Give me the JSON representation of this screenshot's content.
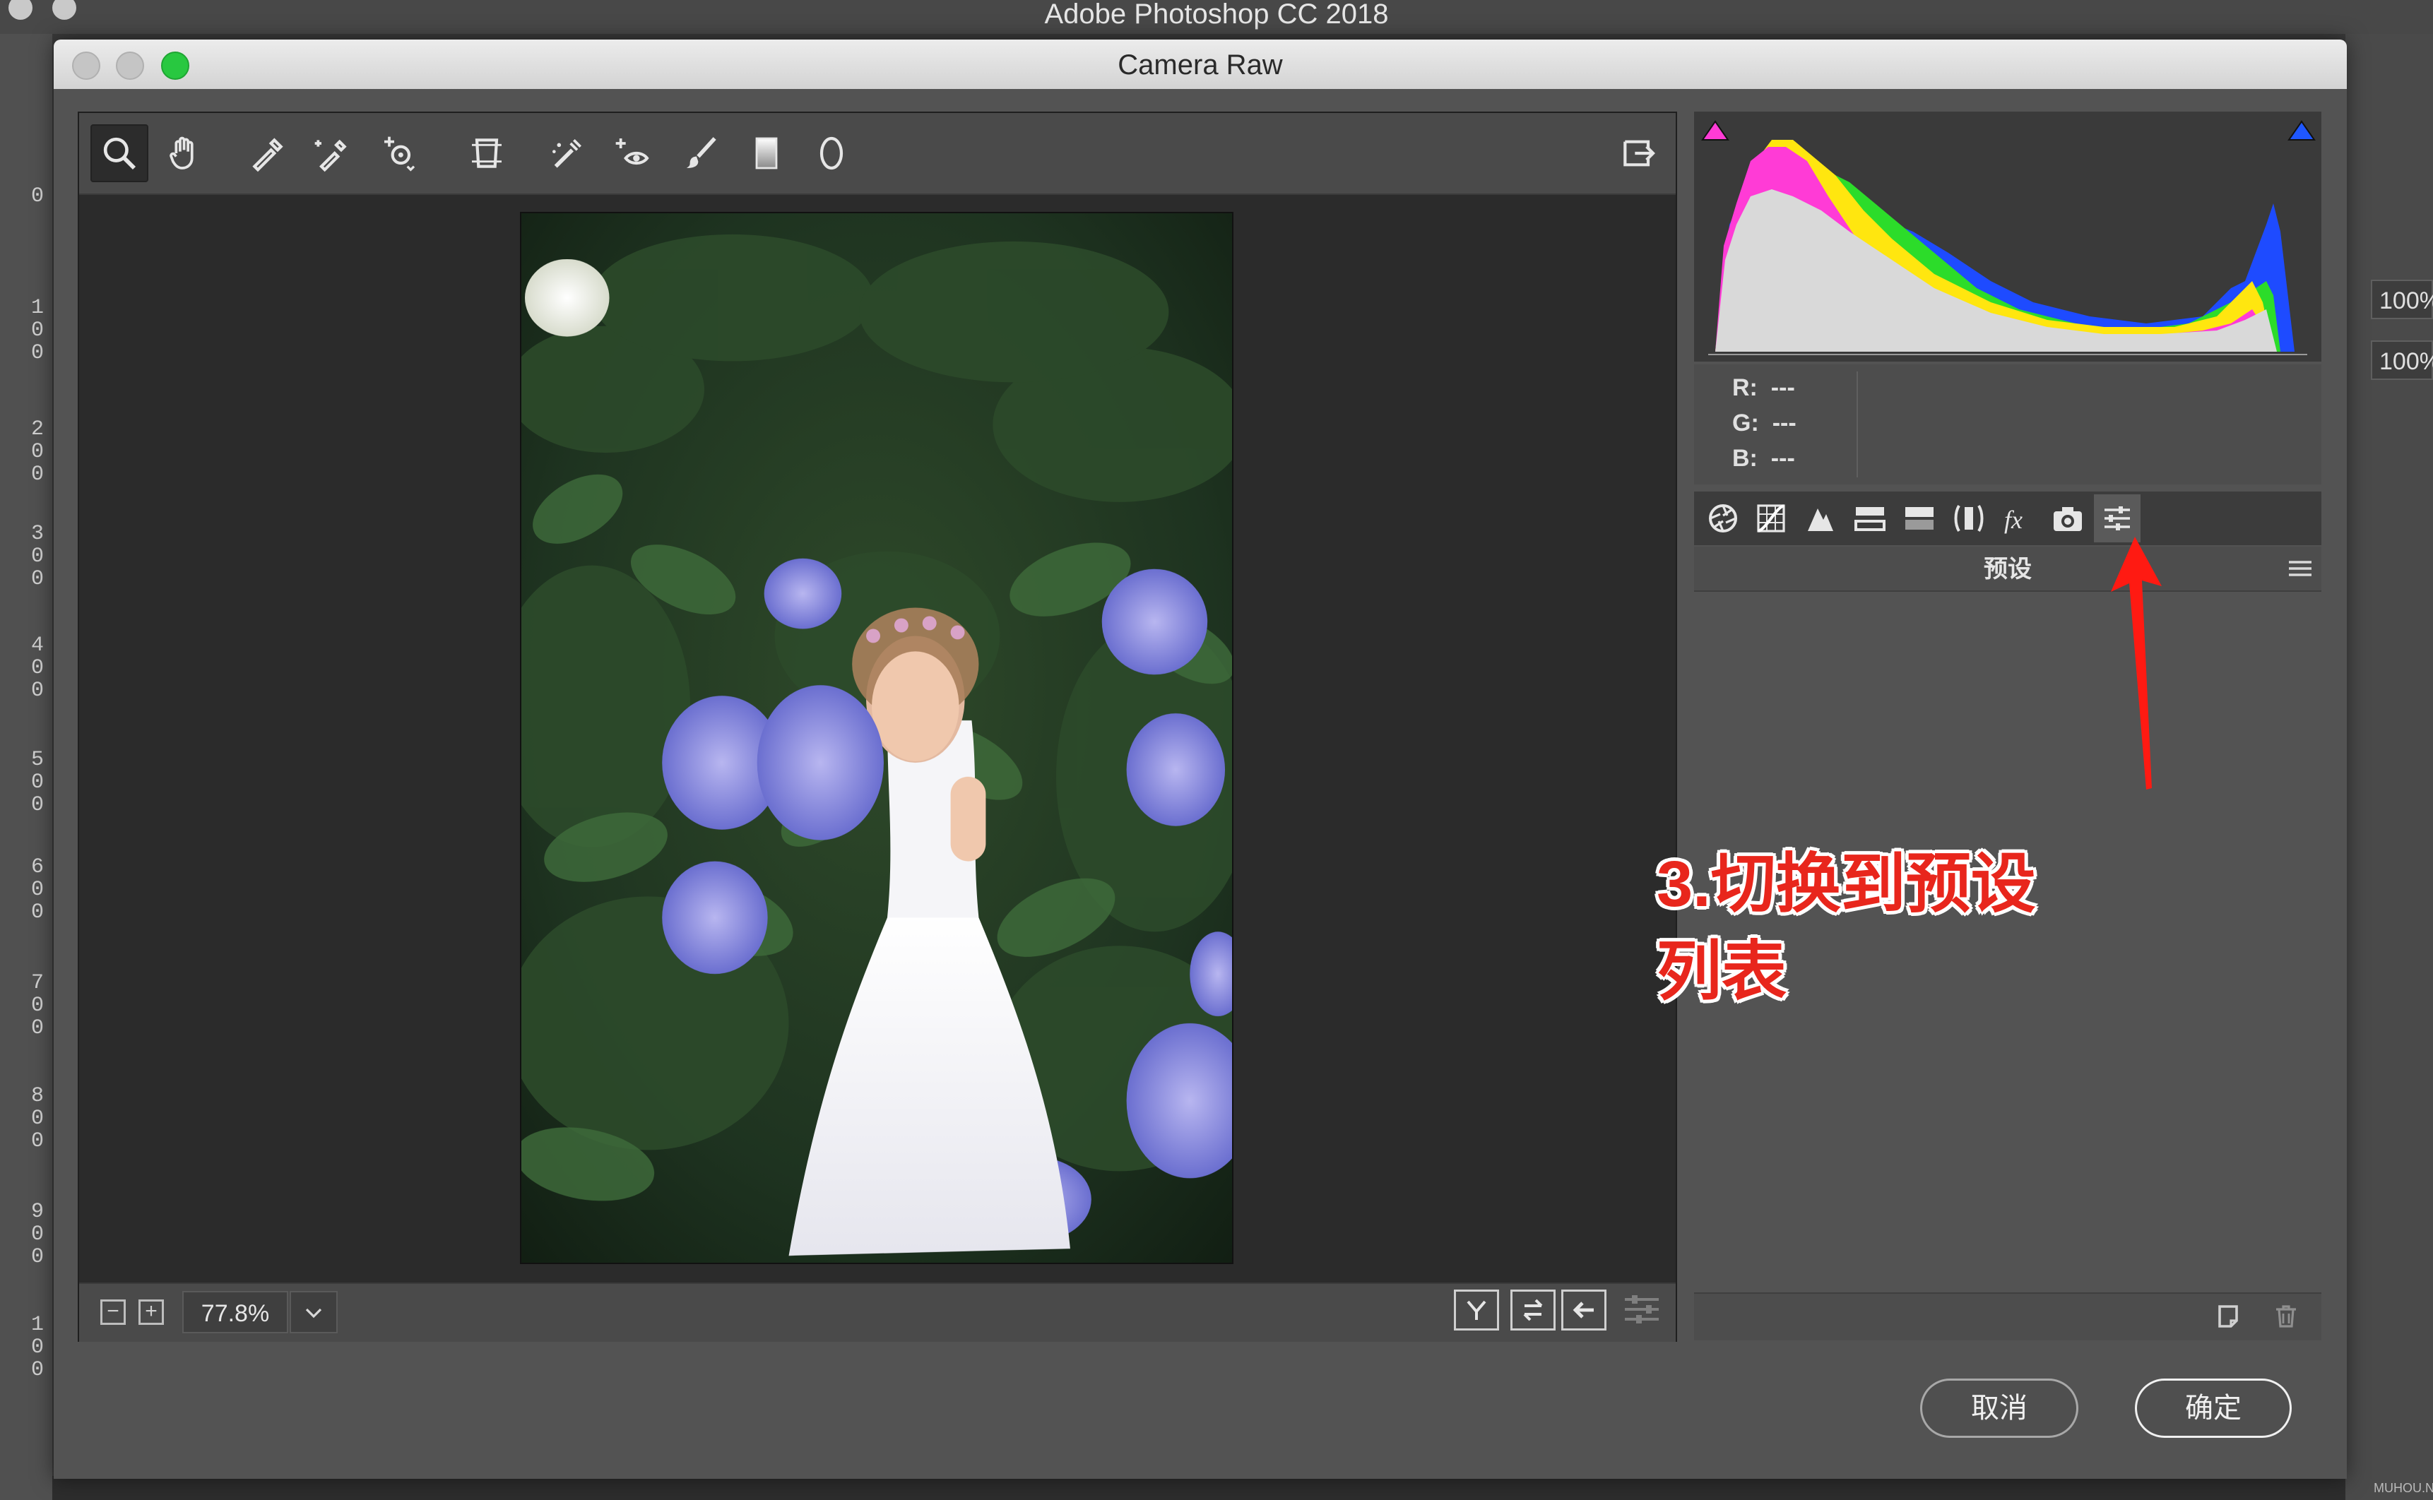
{
  "app": {
    "title": "Adobe Photoshop CC 2018",
    "left_ruler_marks": [
      "0",
      "1\n0\n0",
      "2\n0\n0",
      "3\n0\n0",
      "4\n0\n0",
      "5\n0\n0",
      "6\n0\n0",
      "7\n0\n0",
      "8\n0\n0",
      "9\n0\n0",
      "1\n0\n0"
    ],
    "right_panel_values": [
      "100%",
      "100%"
    ]
  },
  "dialog": {
    "title": "Camera Raw",
    "toolbar_tools": [
      {
        "name": "zoom-tool",
        "icon": "magnifier-icon",
        "active": true
      },
      {
        "name": "hand-tool",
        "icon": "hand-icon"
      },
      {
        "name": "white-balance-tool",
        "icon": "eyedropper-icon"
      },
      {
        "name": "color-sampler-tool",
        "icon": "color-sampler-icon"
      },
      {
        "name": "targeted-adjustment-tool",
        "icon": "target-adjust-icon"
      },
      {
        "name": "transform-tool",
        "icon": "transform-icon"
      },
      {
        "name": "spot-removal-tool",
        "icon": "spot-removal-icon"
      },
      {
        "name": "red-eye-removal-tool",
        "icon": "red-eye-icon"
      },
      {
        "name": "adjustment-brush-tool",
        "icon": "brush-icon"
      },
      {
        "name": "graduated-filter-tool",
        "icon": "gradient-icon"
      },
      {
        "name": "radial-filter-tool",
        "icon": "ellipse-icon"
      }
    ],
    "open_in_photoshop_icon": "export-icon",
    "zoom": {
      "value": "77.8%"
    },
    "readout": {
      "r_label": "R:",
      "r_value": "---",
      "g_label": "G:",
      "g_value": "---",
      "b_label": "B:",
      "b_value": "---"
    },
    "panel_tabs": [
      {
        "icon": "basic-aperture-icon"
      },
      {
        "icon": "tone-curve-icon"
      },
      {
        "icon": "detail-icon"
      },
      {
        "icon": "hsl-icon"
      },
      {
        "icon": "split-toning-icon"
      },
      {
        "icon": "lens-corrections-icon"
      },
      {
        "icon": "effects-fx-icon"
      },
      {
        "icon": "camera-calibration-icon"
      },
      {
        "icon": "presets-sliders-icon",
        "active": true
      }
    ],
    "panel_title": "预设",
    "cancel_label": "取消",
    "ok_label": "确定"
  },
  "annotation": {
    "line1": "3.切换到预设",
    "line2": "列表"
  },
  "watermark": "MUHOU.NET",
  "colors": {
    "annotation_red": "#e8261c",
    "traffic_green": "#28c840",
    "highlight_clip_blue": "#1f57ff",
    "shadow_clip_magenta": "#ff3bd6"
  }
}
